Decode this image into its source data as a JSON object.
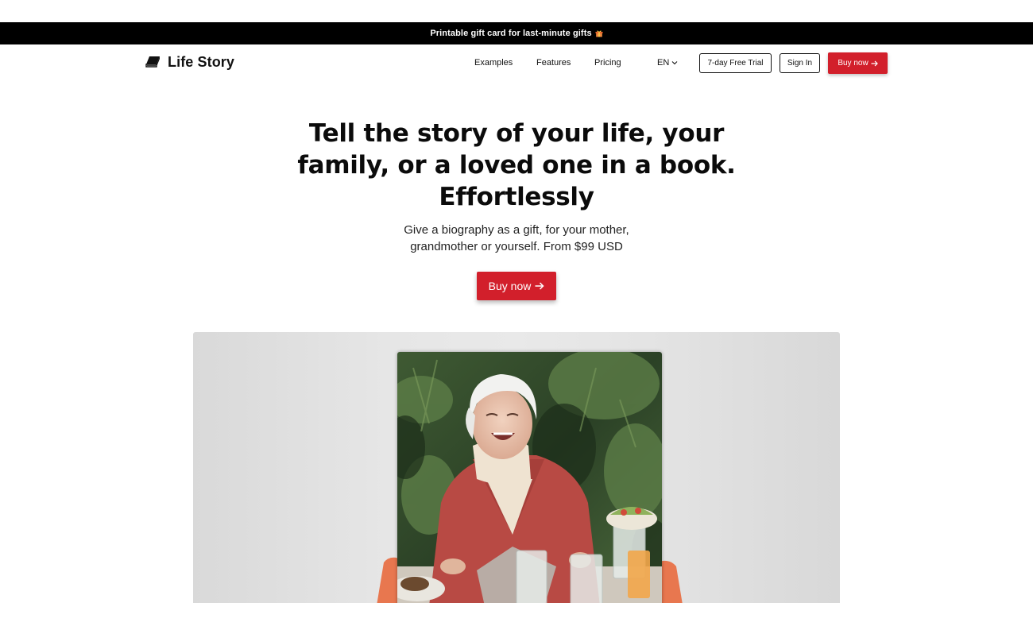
{
  "promo": {
    "text": "Printable gift card for last-minute gifts",
    "icon": "gift-icon"
  },
  "brand": {
    "name": "Life Story",
    "icon": "book-icon",
    "accent": "#d21f2b"
  },
  "nav": {
    "links": [
      "Examples",
      "Features",
      "Pricing"
    ],
    "language": "EN",
    "trial_label": "7-day Free Trial",
    "signin_label": "Sign In",
    "buy_label": "Buy now"
  },
  "hero": {
    "title_line1": "Tell the story of your life, your",
    "title_line2": "family, or a loved one in a book.",
    "title_line3": "Effortlessly",
    "subtitle_line1": "Give a biography as a gift, for your mother,",
    "subtitle_line2": "grandmother or yourself. From $99 USD",
    "cta_label": "Buy now"
  }
}
